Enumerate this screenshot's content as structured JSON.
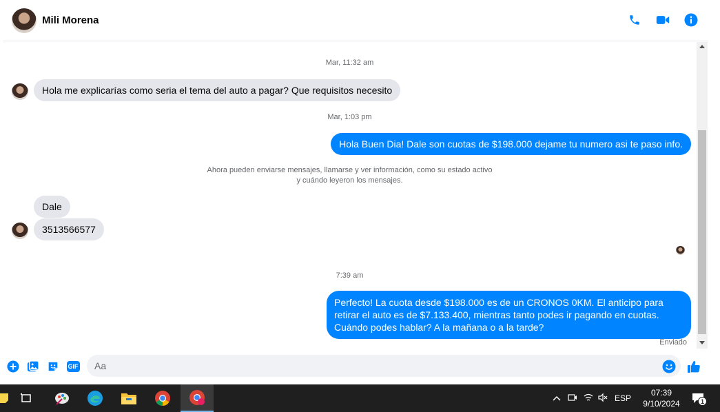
{
  "header": {
    "contact_name": "Mili Morena",
    "icons": [
      "phone-icon",
      "video-icon",
      "info-icon"
    ],
    "accent": "#0084ff"
  },
  "messages": {
    "ts1": "Mar, 11:32 am",
    "m1": "Hola me explicarías como seria el tema del auto a pagar? Que requisitos necesito",
    "ts2": "Mar, 1:03 pm",
    "m2": "Hola Buen Dia! Dale son cuotas de $198.000 dejame tu numero asi te paso info.",
    "notice_line1": "Ahora pueden enviarse mensajes, llamarse y ver información, como su estado activo",
    "notice_line2": "y cuándo leyeron los mensajes.",
    "m3": "Dale",
    "m4": "3513566577",
    "ts3": "7:39 am",
    "m5": "Perfecto! La cuota desde $198.000 es de un CRONOS 0KM. El anticipo para retirar el auto es de $7.133.400, mientras tanto podes ir pagando en cuotas. Cuándo podes hablar? A la mañana o a la tarde?",
    "status": "Enviado"
  },
  "composer": {
    "placeholder": "Aa",
    "icons": [
      "plus-icon",
      "photo-icon",
      "sticker-icon",
      "gif-icon",
      "emoji-icon",
      "thumbs-up-icon"
    ],
    "gif_label": "GIF"
  },
  "taskbar": {
    "language": "ESP",
    "time": "07:39",
    "date": "9/10/2024",
    "notification_count": "1"
  }
}
